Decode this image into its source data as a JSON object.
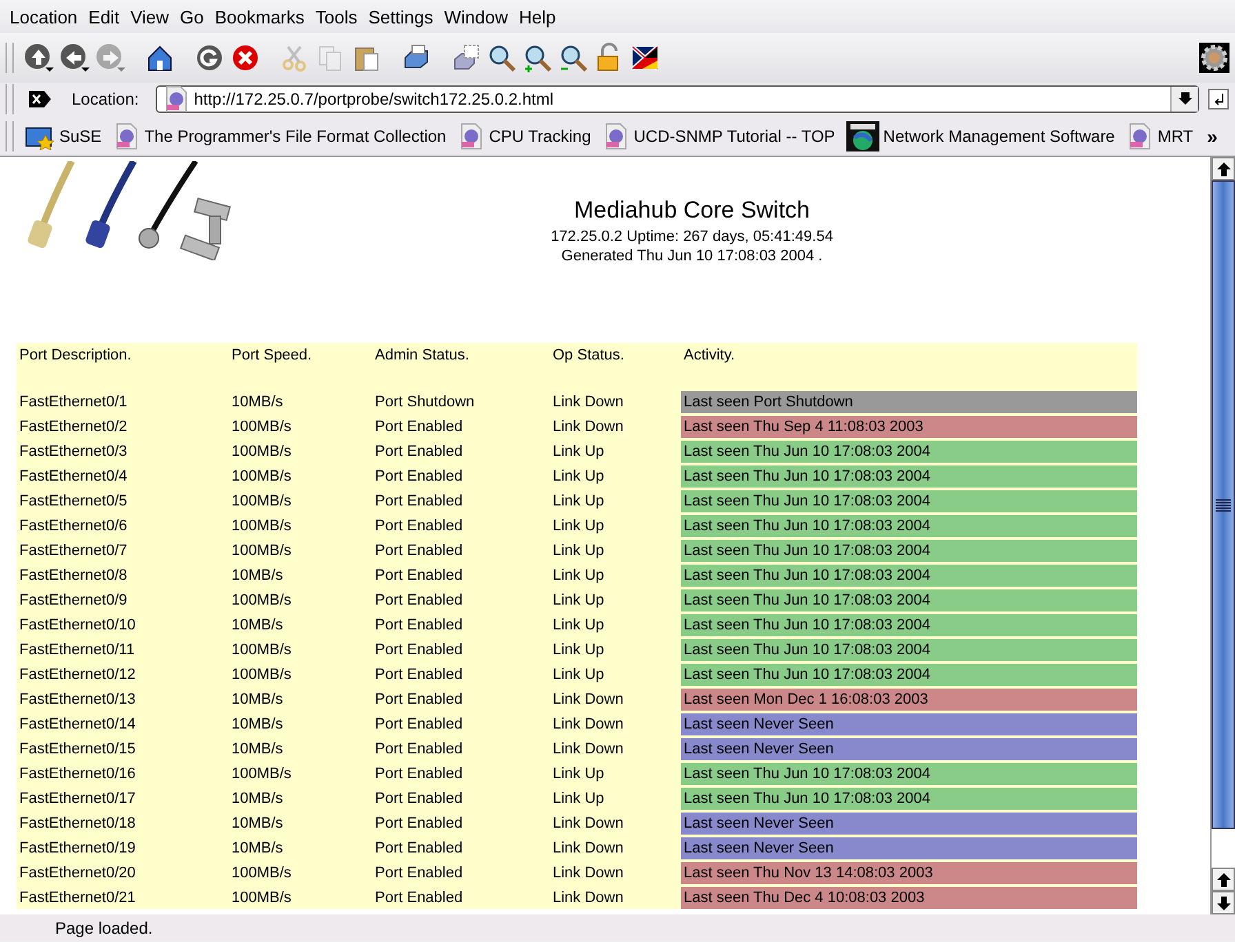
{
  "menu": [
    "Location",
    "Edit",
    "View",
    "Go",
    "Bookmarks",
    "Tools",
    "Settings",
    "Window",
    "Help"
  ],
  "toolbar": [
    {
      "kind": "up",
      "disabled": false
    },
    {
      "kind": "back",
      "disabled": false
    },
    {
      "kind": "forward",
      "disabled": true
    },
    {
      "kind": "home",
      "disabled": false
    },
    {
      "kind": "reload",
      "disabled": false
    },
    {
      "kind": "stop",
      "disabled": false
    },
    {
      "kind": "cut",
      "disabled": true
    },
    {
      "kind": "copy",
      "disabled": true
    },
    {
      "kind": "paste",
      "disabled": false
    },
    {
      "kind": "print",
      "disabled": false
    },
    {
      "kind": "preview",
      "disabled": false
    },
    {
      "kind": "find",
      "disabled": false
    },
    {
      "kind": "zoom-in",
      "disabled": false
    },
    {
      "kind": "zoom-out",
      "disabled": false
    },
    {
      "kind": "lock",
      "disabled": false
    },
    {
      "kind": "flag",
      "disabled": false
    }
  ],
  "location": {
    "label": "Location:",
    "value": "http://172.25.0.7/portprobe/switch172.25.0.2.html"
  },
  "bookmarks": [
    {
      "kind": "folder",
      "label": "SuSE"
    },
    {
      "kind": "page",
      "label": "The Programmer's File Format Collection"
    },
    {
      "kind": "page",
      "label": "CPU Tracking"
    },
    {
      "kind": "page",
      "label": "UCD-SNMP Tutorial -- TOP"
    },
    {
      "kind": "cco",
      "label": "Network Management Software"
    },
    {
      "kind": "page",
      "label": "MRT"
    }
  ],
  "bookmarks_more": "»",
  "page": {
    "title": "Mediahub Core Switch",
    "uptime": "172.25.0.2 Uptime: 267 days, 05:41:49.54",
    "generated": "Generated Thu Jun 10 17:08:03 2004 .",
    "table": {
      "columns": [
        "Port Description.",
        "Port Speed.",
        "Admin Status.",
        "Op Status.",
        "Activity."
      ],
      "rows": [
        {
          "port": "FastEthernet0/1",
          "speed": "10MB/s",
          "admin": "Port Shutdown",
          "op": "Link Down",
          "activity": "Last seen Port Shutdown",
          "color": "#999999"
        },
        {
          "port": "FastEthernet0/2",
          "speed": "100MB/s",
          "admin": "Port Enabled",
          "op": "Link Down",
          "activity": "Last seen Thu Sep 4 11:08:03 2003",
          "color": "#cc8888"
        },
        {
          "port": "FastEthernet0/3",
          "speed": "100MB/s",
          "admin": "Port Enabled",
          "op": "Link Up",
          "activity": "Last seen Thu Jun 10 17:08:03 2004",
          "color": "#88cc88"
        },
        {
          "port": "FastEthernet0/4",
          "speed": "100MB/s",
          "admin": "Port Enabled",
          "op": "Link Up",
          "activity": "Last seen Thu Jun 10 17:08:03 2004",
          "color": "#88cc88"
        },
        {
          "port": "FastEthernet0/5",
          "speed": "100MB/s",
          "admin": "Port Enabled",
          "op": "Link Up",
          "activity": "Last seen Thu Jun 10 17:08:03 2004",
          "color": "#88cc88"
        },
        {
          "port": "FastEthernet0/6",
          "speed": "100MB/s",
          "admin": "Port Enabled",
          "op": "Link Up",
          "activity": "Last seen Thu Jun 10 17:08:03 2004",
          "color": "#88cc88"
        },
        {
          "port": "FastEthernet0/7",
          "speed": "100MB/s",
          "admin": "Port Enabled",
          "op": "Link Up",
          "activity": "Last seen Thu Jun 10 17:08:03 2004",
          "color": "#88cc88"
        },
        {
          "port": "FastEthernet0/8",
          "speed": "10MB/s",
          "admin": "Port Enabled",
          "op": "Link Up",
          "activity": "Last seen Thu Jun 10 17:08:03 2004",
          "color": "#88cc88"
        },
        {
          "port": "FastEthernet0/9",
          "speed": "100MB/s",
          "admin": "Port Enabled",
          "op": "Link Up",
          "activity": "Last seen Thu Jun 10 17:08:03 2004",
          "color": "#88cc88"
        },
        {
          "port": "FastEthernet0/10",
          "speed": "10MB/s",
          "admin": "Port Enabled",
          "op": "Link Up",
          "activity": "Last seen Thu Jun 10 17:08:03 2004",
          "color": "#88cc88"
        },
        {
          "port": "FastEthernet0/11",
          "speed": "100MB/s",
          "admin": "Port Enabled",
          "op": "Link Up",
          "activity": "Last seen Thu Jun 10 17:08:03 2004",
          "color": "#88cc88"
        },
        {
          "port": "FastEthernet0/12",
          "speed": "100MB/s",
          "admin": "Port Enabled",
          "op": "Link Up",
          "activity": "Last seen Thu Jun 10 17:08:03 2004",
          "color": "#88cc88"
        },
        {
          "port": "FastEthernet0/13",
          "speed": "10MB/s",
          "admin": "Port Enabled",
          "op": "Link Down",
          "activity": "Last seen Mon Dec 1 16:08:03 2003",
          "color": "#cc8888"
        },
        {
          "port": "FastEthernet0/14",
          "speed": "10MB/s",
          "admin": "Port Enabled",
          "op": "Link Down",
          "activity": "Last seen Never Seen",
          "color": "#8888cc"
        },
        {
          "port": "FastEthernet0/15",
          "speed": "10MB/s",
          "admin": "Port Enabled",
          "op": "Link Down",
          "activity": "Last seen Never Seen",
          "color": "#8888cc"
        },
        {
          "port": "FastEthernet0/16",
          "speed": "100MB/s",
          "admin": "Port Enabled",
          "op": "Link Up",
          "activity": "Last seen Thu Jun 10 17:08:03 2004",
          "color": "#88cc88"
        },
        {
          "port": "FastEthernet0/17",
          "speed": "10MB/s",
          "admin": "Port Enabled",
          "op": "Link Up",
          "activity": "Last seen Thu Jun 10 17:08:03 2004",
          "color": "#88cc88"
        },
        {
          "port": "FastEthernet0/18",
          "speed": "10MB/s",
          "admin": "Port Enabled",
          "op": "Link Down",
          "activity": "Last seen Never Seen",
          "color": "#8888cc"
        },
        {
          "port": "FastEthernet0/19",
          "speed": "10MB/s",
          "admin": "Port Enabled",
          "op": "Link Down",
          "activity": "Last seen Never Seen",
          "color": "#8888cc"
        },
        {
          "port": "FastEthernet0/20",
          "speed": "100MB/s",
          "admin": "Port Enabled",
          "op": "Link Down",
          "activity": "Last seen Thu Nov 13 14:08:03 2003",
          "color": "#cc8888"
        },
        {
          "port": "FastEthernet0/21",
          "speed": "100MB/s",
          "admin": "Port Enabled",
          "op": "Link Down",
          "activity": "Last seen Thu Dec 4 10:08:03 2003",
          "color": "#cc8888"
        }
      ]
    }
  },
  "status_bar": "Page loaded."
}
